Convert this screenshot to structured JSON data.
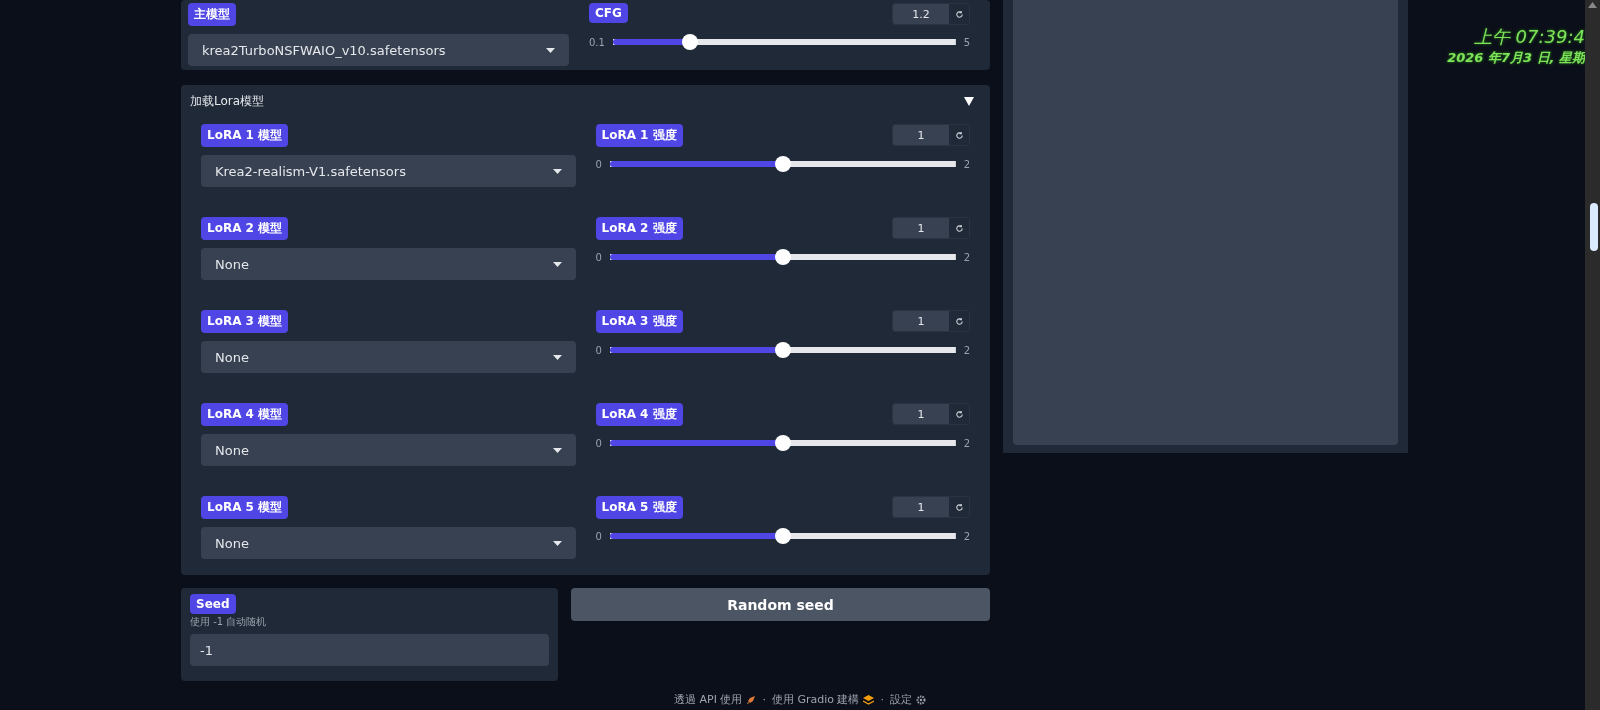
{
  "main_model": {
    "label": "主模型",
    "value": "krea2TurboNSFWAIO_v10.safetensors"
  },
  "cfg": {
    "label": "CFG",
    "value": "1.2",
    "min": "0.1",
    "max": "5",
    "level": 0.224
  },
  "lora_section": {
    "title": "加载Lora模型",
    "expanded": true,
    "rows": [
      {
        "model_label": "LoRA 1 模型",
        "model_value": "Krea2-realism-V1.safetensors",
        "strength_label": "LoRA 1 强度",
        "strength_value": "1",
        "min": "0",
        "max": "2",
        "level": 0.5
      },
      {
        "model_label": "LoRA 2 模型",
        "model_value": "None",
        "strength_label": "LoRA 2 强度",
        "strength_value": "1",
        "min": "0",
        "max": "2",
        "level": 0.5
      },
      {
        "model_label": "LoRA 3 模型",
        "model_value": "None",
        "strength_label": "LoRA 3 强度",
        "strength_value": "1",
        "min": "0",
        "max": "2",
        "level": 0.5
      },
      {
        "model_label": "LoRA 4 模型",
        "model_value": "None",
        "strength_label": "LoRA 4 强度",
        "strength_value": "1",
        "min": "0",
        "max": "2",
        "level": 0.5
      },
      {
        "model_label": "LoRA 5 模型",
        "model_value": "None",
        "strength_label": "LoRA 5 强度",
        "strength_value": "1",
        "min": "0",
        "max": "2",
        "level": 0.5
      }
    ]
  },
  "seed": {
    "label": "Seed",
    "hint": "使用 -1 自动随机",
    "value": "-1"
  },
  "random_seed_button": "Random seed",
  "footer": {
    "api": "透過 API 使用",
    "separator_1": "·",
    "built": "使用 Gradio 建構",
    "separator_2": "·",
    "settings": "設定"
  },
  "clock": {
    "time": "上午 07:39:4",
    "date": "2026 年7月3 日, 星期"
  }
}
